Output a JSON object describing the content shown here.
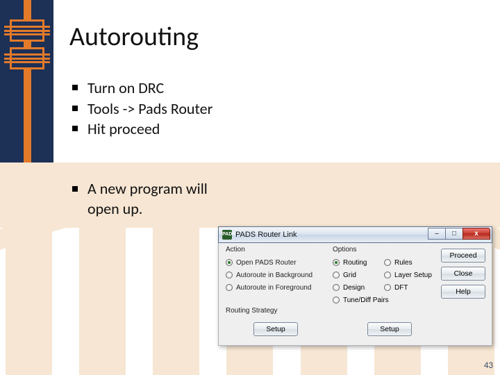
{
  "title": "Autorouting",
  "bullets": [
    "Turn on DRC",
    "Tools -> Pads Router",
    "Hit proceed"
  ],
  "bullets2": [
    "A new program will open up."
  ],
  "page_number": "43",
  "dialog": {
    "app_icon": "PADS",
    "title": "PADS Router Link",
    "groups": {
      "action": {
        "label": "Action",
        "options": [
          {
            "label": "Open PADS Router",
            "selected": true
          },
          {
            "label": "Autoroute in Background",
            "selected": false
          },
          {
            "label": "Autoroute in Foreground",
            "selected": false
          }
        ]
      },
      "options": {
        "label": "Options",
        "rows": [
          [
            {
              "label": "Routing",
              "selected": true
            },
            {
              "label": "Rules",
              "selected": false
            }
          ],
          [
            {
              "label": "Grid",
              "selected": false
            },
            {
              "label": "Layer Setup",
              "selected": false
            }
          ],
          [
            {
              "label": "Design",
              "selected": false
            },
            {
              "label": "DFT",
              "selected": false
            }
          ],
          [
            {
              "label": "Tune/Diff Pairs",
              "selected": false
            }
          ]
        ]
      },
      "strategy": {
        "label": "Routing Strategy"
      }
    },
    "buttons": {
      "proceed": "Proceed",
      "close": "Close",
      "help": "Help",
      "setup": "Setup"
    },
    "window_controls": {
      "minimize": "–",
      "maximize": "□",
      "close": "x"
    }
  }
}
